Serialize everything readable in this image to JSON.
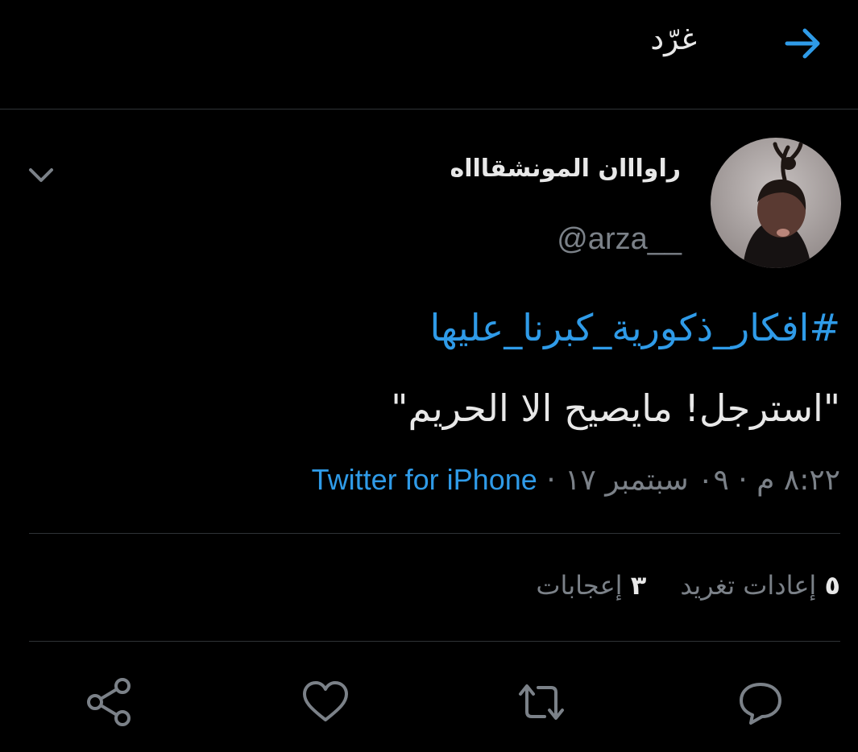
{
  "header": {
    "title": "غرّد",
    "back_icon": "arrow-right-icon"
  },
  "tweet": {
    "display_name": "راوااان المونشقاااه",
    "handle": "@arza__",
    "hashtag": "#افكار_ذكورية_كبرنا_عليها",
    "text": "\"استرجل! مايصيح الا الحريم\"",
    "time": "٨:٢٢ م · ٠٩ سبتمبر ١٧",
    "separator": "·",
    "source": "Twitter for iPhone"
  },
  "stats": {
    "retweets_count": "٥",
    "retweets_label": "إعادات تغريد",
    "likes_count": "٣",
    "likes_label": "إعجابات"
  },
  "actions": {
    "reply_icon": "reply-icon",
    "retweet_icon": "retweet-icon",
    "like_icon": "heart-icon",
    "share_icon": "share-icon"
  },
  "colors": {
    "background": "#000000",
    "accent": "#2f9be8",
    "secondary_text": "#7b8188",
    "divider": "#2f3336"
  }
}
